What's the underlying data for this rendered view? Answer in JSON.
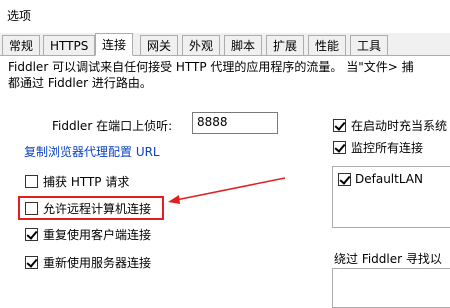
{
  "window": {
    "title": "选项"
  },
  "tabs": [
    {
      "label": "常规",
      "active": false
    },
    {
      "label": "HTTPS",
      "active": false
    },
    {
      "label": "连接",
      "active": true
    },
    {
      "label": "网关",
      "active": false
    },
    {
      "label": "外观",
      "active": false
    },
    {
      "label": "脚本",
      "active": false
    },
    {
      "label": "扩展",
      "active": false
    },
    {
      "label": "性能",
      "active": false
    },
    {
      "label": "工具",
      "active": false
    }
  ],
  "description": {
    "line1": "Fiddler 可以调试来自任何接受 HTTP 代理的应用程序的流量。 当\"文件> 捕",
    "line2": "都通过 Fiddler 进行路由。"
  },
  "port": {
    "label": "Fiddler 在端口上侦听:",
    "value": "8888"
  },
  "copy_link": "复制浏览器代理配置 URL",
  "options": {
    "capture_http": {
      "label": "捕获 HTTP 请求",
      "checked": false
    },
    "allow_remote": {
      "label": "允许远程计算机连接",
      "checked": false
    },
    "reuse_client": {
      "label": "重复使用客户端连接",
      "checked": true
    },
    "reuse_server": {
      "label": "重新使用服务器连接",
      "checked": true
    }
  },
  "right": {
    "startup_label": "在启动时充当系统",
    "startup_checked": true,
    "monitor_label": "监控所有连接",
    "monitor_checked": true,
    "connections": [
      {
        "label": "DefaultLAN",
        "checked": true
      }
    ],
    "bypass_label": "绕过 Fiddler 寻找以"
  },
  "colors": {
    "highlight": "#e02020",
    "link": "#0b42c2"
  }
}
